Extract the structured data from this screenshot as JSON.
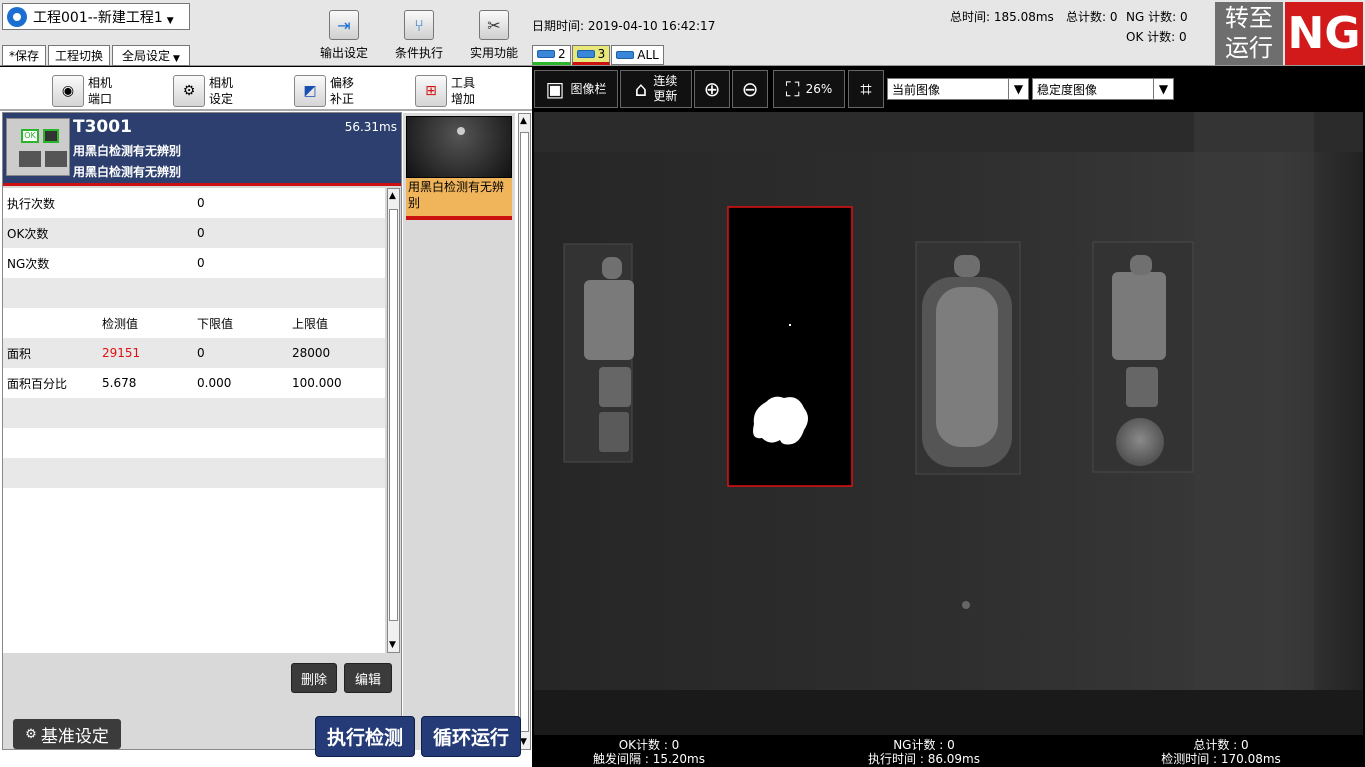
{
  "project": {
    "name": "工程001--新建工程1"
  },
  "topbar": {
    "save_label": "*保存",
    "switch_label": "工程切换",
    "global_label": "全局设定",
    "tools": [
      {
        "label": "输出设定"
      },
      {
        "label": "条件执行"
      },
      {
        "label": "实用功能"
      }
    ],
    "datetime_label": "日期时间:",
    "datetime_value": "2019-04-10 16:42:17",
    "cams": [
      {
        "label": "2"
      },
      {
        "label": "3"
      },
      {
        "label": "ALL"
      }
    ],
    "total_time": "总时间: 185.08ms",
    "total_count": "总计数: 0",
    "ng_count": "NG 计数: 0",
    "ok_count": "OK 计数: 0",
    "turn_line1": "转至",
    "turn_line2": "运行",
    "status": "NG"
  },
  "left_tools": [
    {
      "l1": "相机",
      "l2": "端口"
    },
    {
      "l1": "相机",
      "l2": "设定"
    },
    {
      "l1": "偏移",
      "l2": "补正"
    },
    {
      "l1": "工具",
      "l2": "增加"
    }
  ],
  "tool_header": {
    "id": "T3001",
    "time": "56.31ms",
    "line1": "用黑白检测有无辨别",
    "line2": "用黑白检测有无辨别"
  },
  "stats": [
    {
      "label": "执行次数",
      "value": "0"
    },
    {
      "label": "OK次数",
      "value": "0"
    },
    {
      "label": "NG次数",
      "value": "0"
    }
  ],
  "measure_headers": {
    "detect": "检测值",
    "low": "下限值",
    "high": "上限值"
  },
  "measures": [
    {
      "name": "面积",
      "detect": "29151",
      "low": "0",
      "high": "28000"
    },
    {
      "name": "面积百分比",
      "detect": "5.678",
      "low": "0.000",
      "high": "100.000"
    }
  ],
  "actions": {
    "delete": "删除",
    "edit": "编辑"
  },
  "thumb_label": "用黑白检测有无辨别",
  "bottom_buttons": {
    "base": "基准设定",
    "run": "执行检测",
    "loop": "循环运行"
  },
  "right_toolbar": {
    "image_bar": "图像栏",
    "continuous_l1": "连续",
    "continuous_l2": "更新",
    "zoom": "26%",
    "current_image": "当前图像",
    "stable_image": "稳定度图像"
  },
  "colors": {
    "ng_red": "#d21a1a",
    "navy": "#243b78",
    "detect_red": "#dd1111"
  },
  "footer": {
    "ok": "OK计数 : 0",
    "trigger": "触发间隔 : 15.20ms",
    "ng": "NG计数 : 0",
    "exec": "执行时间 : 86.09ms",
    "total": "总计数 : 0",
    "detect": "检测时间 : 170.08ms"
  }
}
